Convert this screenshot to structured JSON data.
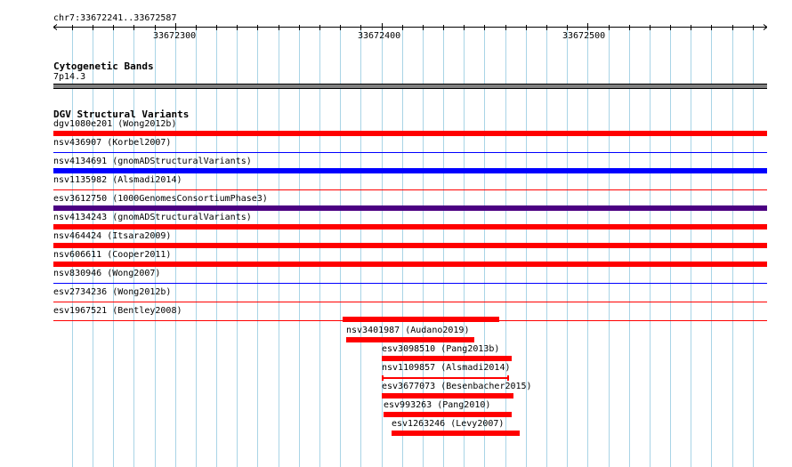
{
  "ruler": {
    "location": "chr7:33672241..33672587",
    "ticks": [
      "33672300",
      "33672400",
      "33672500"
    ]
  },
  "cytoband": {
    "title": "Cytogenetic Bands",
    "band": "7p14.3",
    "color": "#808080"
  },
  "dgv": {
    "title": "DGV Structural Variants",
    "colors": {
      "loss": "#ff0000",
      "gain": "#0000ff",
      "complex": "#4b0082"
    },
    "full_rows": [
      {
        "label": "dgv1080e201 (Wong2012b)",
        "style": "bar",
        "color": "#ff0000"
      },
      {
        "label": "nsv436907 (Korbel2007)",
        "style": "thin",
        "color": "#0000ff"
      },
      {
        "label": "nsv4134691 (gnomADStructuralVariants)",
        "style": "bar",
        "color": "#0000ff"
      },
      {
        "label": "nsv1135982 (Alsmadi2014)",
        "style": "thin",
        "color": "#ff0000"
      },
      {
        "label": "esv3612750 (1000GenomesConsortiumPhase3)",
        "style": "bar",
        "color": "#4b0082"
      },
      {
        "label": "nsv4134243 (gnomADStructuralVariants)",
        "style": "bar",
        "color": "#ff0000"
      },
      {
        "label": "nsv464424 (Itsara2009)",
        "style": "bar",
        "color": "#ff0000"
      },
      {
        "label": "nsv606611 (Cooper2011)",
        "style": "bar",
        "color": "#ff0000"
      },
      {
        "label": "nsv830946 (Wong2007)",
        "style": "thin",
        "color": "#0000ff"
      },
      {
        "label": "esv2734236 (Wong2012b)",
        "style": "thin",
        "color": "#ff0000"
      },
      {
        "label": "esv1967521 (Bentley2008)",
        "style": "thin",
        "color": "#ff0000"
      }
    ],
    "partial_rows": [
      {
        "label": "nsv3401987 (Audano2019)",
        "start": 33672381,
        "end": 33672457,
        "color": "#ff0000",
        "label_above": false
      },
      {
        "label": "nsv3401987 (Audano2019)",
        "start": 33672383,
        "end": 33672445,
        "color": "#ff0000",
        "label_above": true
      },
      {
        "label": "esv3098510 (Pang2013b)",
        "start": 33672400,
        "end": 33672463,
        "color": "#ff0000",
        "label_above": true
      },
      {
        "label": "nsv1109857 (Alsmadi2014)",
        "start": 33672400,
        "end": 33672462,
        "color": "#ff0000",
        "label_above": true,
        "style": "interval"
      },
      {
        "label": "esv3677073 (Besenbacher2015)",
        "start": 33672400,
        "end": 33672464,
        "color": "#ff0000",
        "label_above": true
      },
      {
        "label": "esv993263 (Pang2010)",
        "start": 33672401,
        "end": 33672463,
        "color": "#ff0000",
        "label_above": true
      },
      {
        "label": "esv1263246 (Levy2007)",
        "start": 33672405,
        "end": 33672467,
        "color": "#ff0000",
        "label_above": true
      }
    ]
  }
}
